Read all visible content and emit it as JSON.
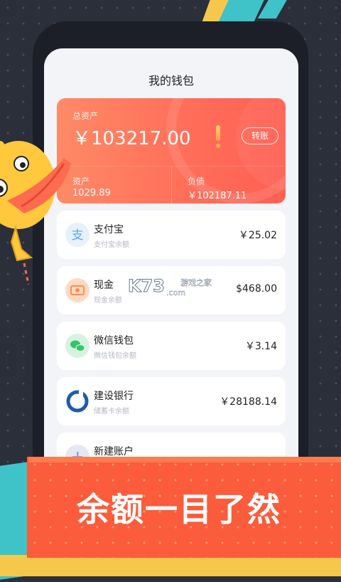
{
  "wallet": {
    "title": "我的钱包",
    "summary": {
      "total_label": "总资产",
      "total_value": "￥103217.00",
      "transfer_label": "转账",
      "assets_label": "资产",
      "assets_value": "1029.89",
      "debt_label": "负债",
      "debt_value": "￥102187.11"
    },
    "accounts": [
      {
        "name": "支付宝",
        "desc": "支付宝余额",
        "amount": "￥25.02",
        "icon": "alipay-icon",
        "color": "#5aa9ec"
      },
      {
        "name": "现金",
        "desc": "现金余额",
        "amount": "$468.00",
        "icon": "cash-icon",
        "color": "#ff9f6e"
      },
      {
        "name": "微信钱包",
        "desc": "微信钱包余额",
        "amount": "￥3.14",
        "icon": "wechat-icon",
        "color": "#35c46a"
      },
      {
        "name": "建设银行",
        "desc": "储蓄卡余额",
        "amount": "￥28188.14",
        "icon": "ccb-bank-icon",
        "color": "#1f5ba8"
      },
      {
        "name": "新建账户",
        "desc": "",
        "amount": "",
        "icon": "add-account-icon",
        "color": "#8fa4c8"
      }
    ]
  },
  "banner": {
    "slogan": "余额一目了然"
  },
  "watermark": {
    "brand": "K73",
    "domain": ".com",
    "tagline": "游戏之家"
  }
}
